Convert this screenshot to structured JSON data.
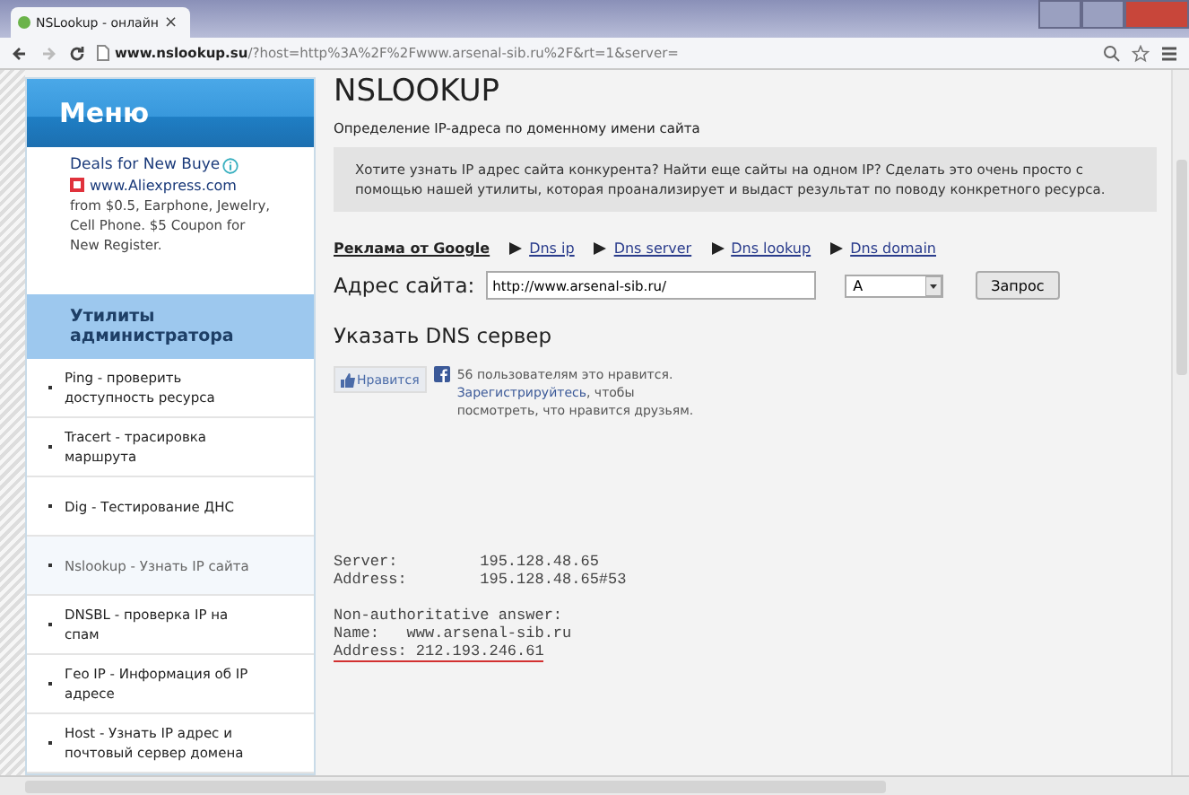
{
  "browser": {
    "tab": {
      "title": "NSLookup - онлайн",
      "close": "×"
    },
    "url": {
      "host": "www.nslookup.su",
      "path": "/?host=http%3A%2F%2Fwww.arsenal-sib.ru%2F&rt=1&server="
    }
  },
  "sidebar": {
    "menu_title": "Меню",
    "ad": {
      "title": "Deals for New Buye",
      "site": "www.Aliexpress.com",
      "text": "from $0.5, Earphone, Jewelry, Cell Phone. $5 Coupon for New Register."
    },
    "section_title": "Утилиты администратора",
    "items": [
      {
        "label": "Ping - проверить доступность ресурса",
        "selected": false
      },
      {
        "label": "Tracert - трасировка маршрута",
        "selected": false
      },
      {
        "label": "Dig - Тестирование ДНС",
        "selected": false
      },
      {
        "label": "Nslookup - Узнать IP сайта",
        "selected": true
      },
      {
        "label": "DNSBL - проверка IP на спам",
        "selected": false
      },
      {
        "label": "Гео IP - Информация об IP адресе",
        "selected": false
      },
      {
        "label": "Host - Узнать IP адрес и почтовый сервер домена",
        "selected": false
      }
    ]
  },
  "main": {
    "title": "NSLOOKUP",
    "subtitle": "Определение IP-адреса по доменному имени сайта",
    "info": "Хотите узнать IP адрес сайта конкурента? Найти еще сайты на одном IP? Сделать это очень просто с помощью нашей утилиты, которая проанализирует и выдаст результат по поводу конкретного ресурса.",
    "ads_label": "Реклама от Google",
    "ad_links": [
      "Dns ip",
      "Dns server",
      "Dns lookup",
      "Dns domain"
    ],
    "form": {
      "label": "Адрес сайта:",
      "value": "http://www.arsenal-sib.ru/",
      "record_type": "A",
      "submit": "Запрос"
    },
    "dns_server_heading": "Указать DNS сервер",
    "like": {
      "button": "Нравится",
      "count_text": "56 пользователям это нравится.",
      "register_link": "Зарегистрируйтесь",
      "rest": ", чтобы посмотреть, что нравится друзьям."
    },
    "output": [
      {
        "lines": [
          {
            "text": "Server:         195.128.48.65",
            "underlined": false
          },
          {
            "text": "Address:        195.128.48.65#53",
            "underlined": false
          }
        ]
      },
      {
        "lines": [
          {
            "text": "Non-authoritative answer:",
            "underlined": false
          },
          {
            "text": "Name:   www.arsenal-sib.ru",
            "underlined": false
          },
          {
            "text": "Address: 212.193.246.61",
            "underlined": true
          }
        ]
      }
    ]
  }
}
